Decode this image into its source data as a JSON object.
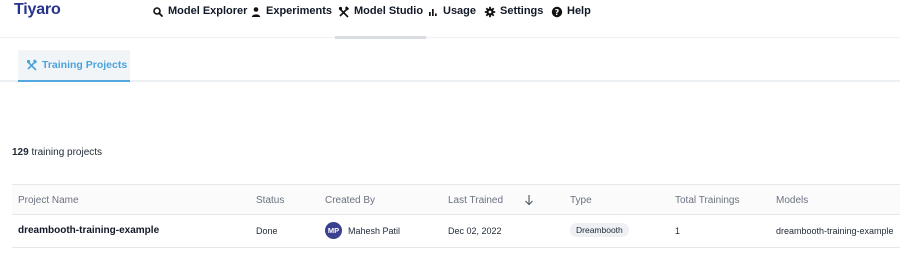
{
  "header": {
    "logo": "Tiyaro",
    "nav": [
      {
        "label": "Model Explorer",
        "icon": "search-icon"
      },
      {
        "label": "Experiments",
        "icon": "user-icon"
      },
      {
        "label": "Model Studio",
        "icon": "tools-icon",
        "active": true
      },
      {
        "label": "Usage",
        "icon": "bar-chart-icon"
      },
      {
        "label": "Settings",
        "icon": "gear-icon"
      },
      {
        "label": "Help",
        "icon": "help-icon"
      }
    ]
  },
  "subtabs": [
    {
      "label": "Training Projects",
      "icon": "tools-icon",
      "active": true
    }
  ],
  "summary": {
    "count": "129",
    "suffix": "training projects"
  },
  "table": {
    "columns": [
      "Project Name",
      "Status",
      "Created By",
      "Last Trained",
      "Type",
      "Total Trainings",
      "Models"
    ],
    "sorted_column": "Last Trained",
    "sort_direction": "descending",
    "rows": [
      {
        "project_name": "dreambooth-training-example",
        "status": "Done",
        "creator_initials": "MP",
        "creator_name": "Mahesh Patil",
        "last_trained": "Dec 02, 2022",
        "type": "Dreambooth",
        "total_trainings": "1",
        "models": "dreambooth-training-example"
      }
    ]
  },
  "colors": {
    "brand": "#27348b",
    "accent": "#4aa3dc",
    "avatar_bg": "#3b3f8f"
  }
}
